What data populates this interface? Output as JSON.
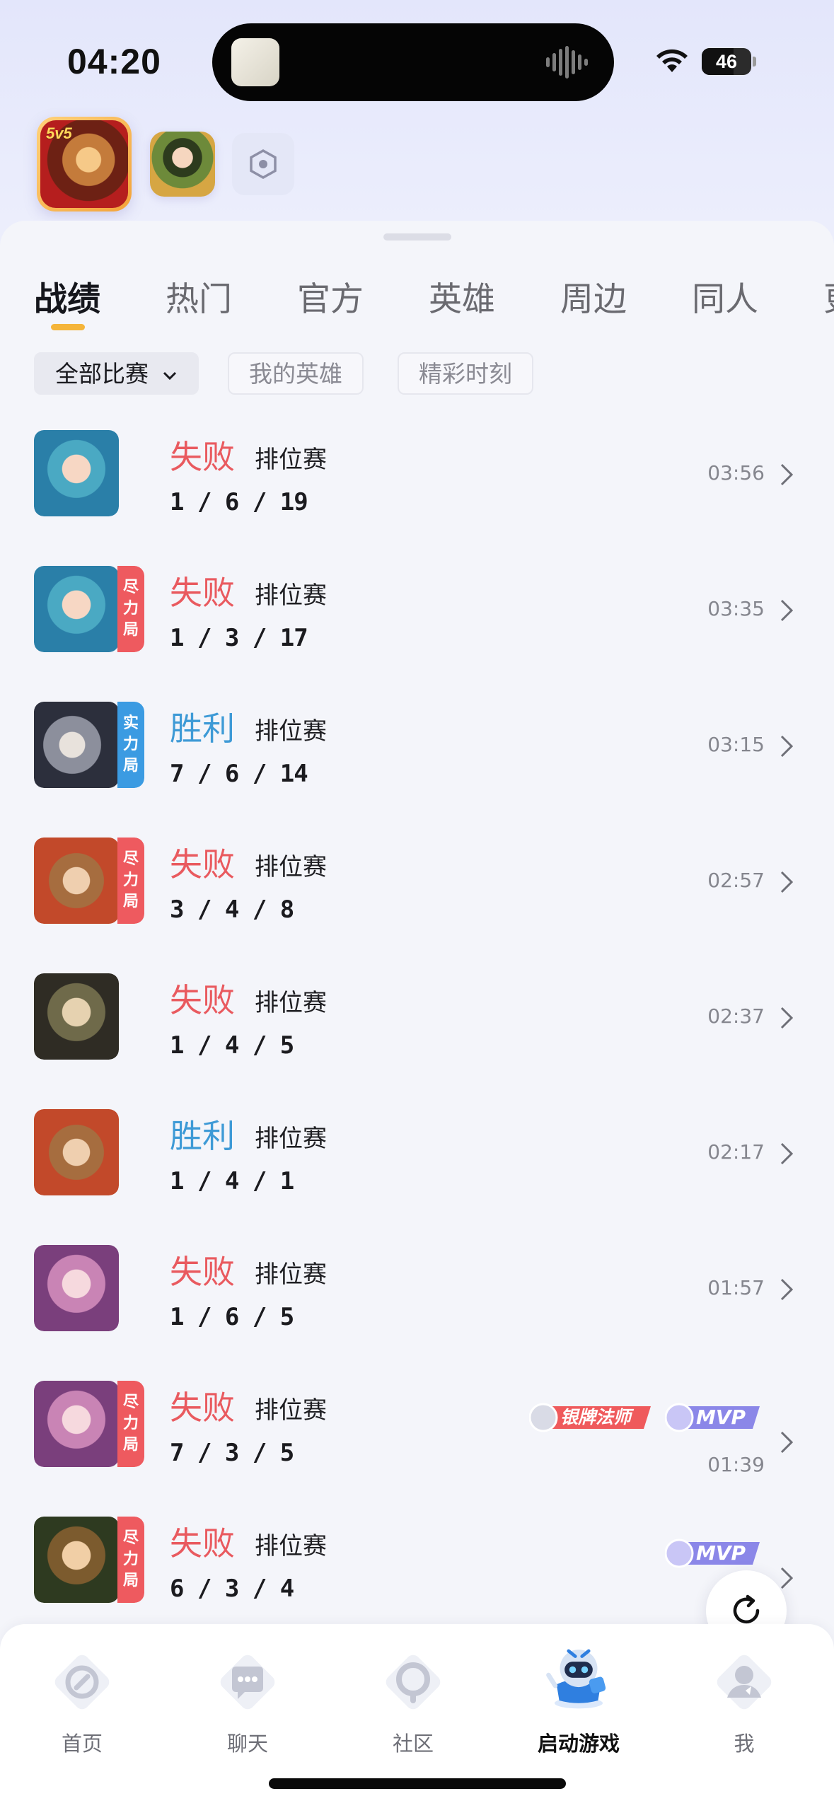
{
  "status_bar": {
    "time": "04:20",
    "battery": "46"
  },
  "game_switcher": {
    "main_game_tag": "5v5"
  },
  "tabs": [
    {
      "label": "战绩",
      "active": true
    },
    {
      "label": "热门",
      "active": false
    },
    {
      "label": "官方",
      "active": false
    },
    {
      "label": "英雄",
      "active": false
    },
    {
      "label": "周边",
      "active": false
    },
    {
      "label": "同人",
      "active": false
    },
    {
      "label": "更",
      "active": false
    }
  ],
  "filters": [
    {
      "label": "全部比赛",
      "active": true
    },
    {
      "label": "我的英雄",
      "active": false
    },
    {
      "label": "精彩时刻",
      "active": false
    }
  ],
  "matches": [
    {
      "result": "失败",
      "outcome": "loss",
      "mode": "排位赛",
      "kda": "1 / 6 / 19",
      "duration": "03:56",
      "badge": null,
      "tags": []
    },
    {
      "result": "失败",
      "outcome": "loss",
      "mode": "排位赛",
      "kda": "1 / 3 / 17",
      "duration": "03:35",
      "badge": {
        "text": [
          "尽",
          "力",
          "局"
        ],
        "color": "#ee5a5f"
      },
      "tags": []
    },
    {
      "result": "胜利",
      "outcome": "win",
      "mode": "排位赛",
      "kda": "7 / 6 / 14",
      "duration": "03:15",
      "badge": {
        "text": [
          "实",
          "力",
          "局"
        ],
        "color": "#3b9be2"
      },
      "tags": []
    },
    {
      "result": "失败",
      "outcome": "loss",
      "mode": "排位赛",
      "kda": "3 / 4 / 8",
      "duration": "02:57",
      "badge": {
        "text": [
          "尽",
          "力",
          "局"
        ],
        "color": "#ee5a5f"
      },
      "tags": []
    },
    {
      "result": "失败",
      "outcome": "loss",
      "mode": "排位赛",
      "kda": "1 / 4 / 5",
      "duration": "02:37",
      "badge": null,
      "tags": []
    },
    {
      "result": "胜利",
      "outcome": "win",
      "mode": "排位赛",
      "kda": "1 / 4 / 1",
      "duration": "02:17",
      "badge": null,
      "tags": []
    },
    {
      "result": "失败",
      "outcome": "loss",
      "mode": "排位赛",
      "kda": "1 / 6 / 5",
      "duration": "01:57",
      "badge": null,
      "tags": []
    },
    {
      "result": "失败",
      "outcome": "loss",
      "mode": "排位赛",
      "kda": "7 / 3 / 5",
      "duration": "01:39",
      "badge": {
        "text": [
          "尽",
          "力",
          "局"
        ],
        "color": "#ee5a5f"
      },
      "tags": [
        "银牌法师",
        "MVP"
      ]
    },
    {
      "result": "失败",
      "outcome": "loss",
      "mode": "排位赛",
      "kda": "6 / 3 / 4",
      "duration": "",
      "badge": {
        "text": [
          "尽",
          "力",
          "局"
        ],
        "color": "#ee5a5f"
      },
      "tags": [
        "MVP"
      ]
    }
  ],
  "bottom_nav": [
    {
      "label": "首页",
      "icon": "home-icon",
      "active": false
    },
    {
      "label": "聊天",
      "icon": "chat-icon",
      "active": false
    },
    {
      "label": "社区",
      "icon": "community-icon",
      "active": false
    },
    {
      "label": "启动游戏",
      "icon": "launch-game-mascot-icon",
      "active": true
    },
    {
      "label": "我",
      "icon": "profile-icon",
      "active": false
    }
  ],
  "colors": {
    "loss": "#e95a5f",
    "win": "#3e9ad6",
    "accent": "#f5b53a"
  }
}
